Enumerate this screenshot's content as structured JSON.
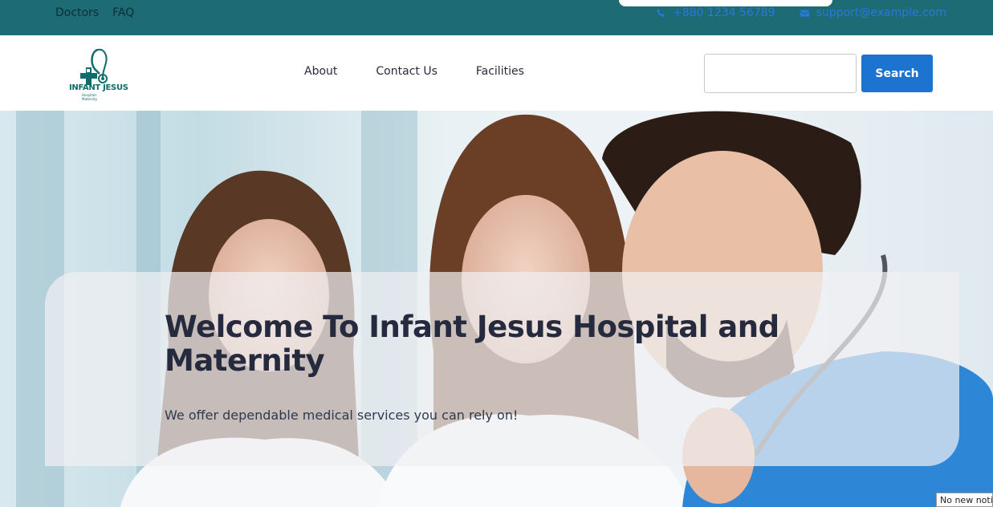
{
  "topbar": {
    "links": [
      "Doctors",
      "FAQ"
    ],
    "phone": "+880 1234 56789",
    "email": "support@example.com",
    "phone_icon": "phone-icon",
    "email_icon": "envelope-icon"
  },
  "logo": {
    "text": "INFANT JESUS",
    "sub1": "Hospitals",
    "sub2": "Maternity"
  },
  "nav": {
    "items": [
      "About",
      "Contact Us",
      "Facilities"
    ],
    "search_value": "",
    "search_button": "Search"
  },
  "hero": {
    "title": "Welcome To Infant Jesus Hospital and Maternity",
    "subtitle": "We offer dependable medical services you can rely on!"
  },
  "notification": {
    "text": "No new notifications"
  },
  "colors": {
    "topbar": "#1d6b74",
    "accent": "#1d73d0",
    "logo": "#0e6d6b"
  }
}
